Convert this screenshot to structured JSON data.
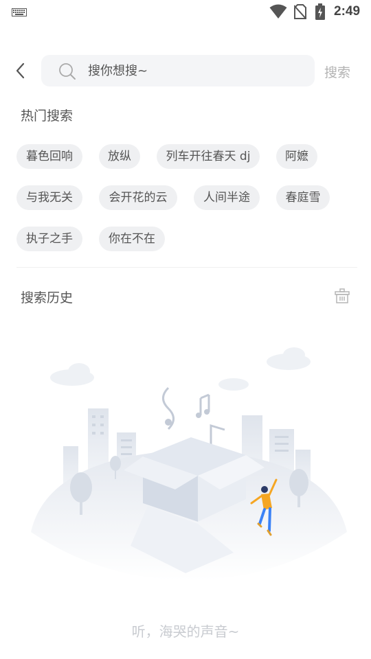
{
  "status_bar": {
    "time": "2:49",
    "icons": [
      "keyboard-icon",
      "wifi-icon",
      "no-sim-icon",
      "battery-charging-icon"
    ]
  },
  "search": {
    "back_icon": "chevron-left-icon",
    "placeholder": "搜你想搜~",
    "value": "",
    "button_label": "搜索"
  },
  "hot_search": {
    "title": "热门搜索",
    "items": [
      "暮色回响",
      "放纵",
      "列车开往春天 dj",
      "阿嬷",
      "与我无关",
      "会开花的云",
      "人间半途",
      "春庭雪",
      "执子之手",
      "你在不在"
    ]
  },
  "history": {
    "title": "搜索历史",
    "clear_icon": "trash-icon",
    "empty_text": "听，海哭的声音~"
  },
  "colors": {
    "chip_bg": "#eff0f2",
    "search_bg": "#f4f5f7",
    "muted_text": "#b3b3b3",
    "accent_figure": "#f5a623"
  }
}
